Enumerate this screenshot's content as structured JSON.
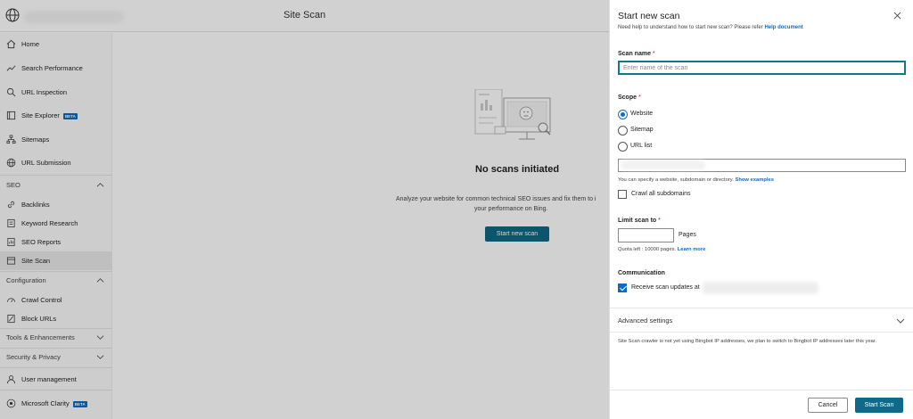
{
  "header": {
    "title": "Site Scan"
  },
  "sidebar": {
    "items": [
      {
        "label": "Home",
        "icon": "home-icon"
      },
      {
        "label": "Search Performance",
        "icon": "trend-icon"
      },
      {
        "label": "URL Inspection",
        "icon": "search-icon"
      },
      {
        "label": "Site Explorer",
        "icon": "folder-icon",
        "badge": "BETA"
      },
      {
        "label": "Sitemaps",
        "icon": "sitemap-icon"
      },
      {
        "label": "URL Submission",
        "icon": "globe-icon"
      }
    ],
    "seo_section": "SEO",
    "seo_items": [
      {
        "label": "Backlinks",
        "icon": "link-icon"
      },
      {
        "label": "Keyword Research",
        "icon": "key-icon"
      },
      {
        "label": "SEO Reports",
        "icon": "report-icon"
      },
      {
        "label": "Site Scan",
        "icon": "scan-icon",
        "active": true
      }
    ],
    "config_section": "Configuration",
    "config_items": [
      {
        "label": "Crawl Control",
        "icon": "gauge-icon"
      },
      {
        "label": "Block URLs",
        "icon": "block-icon"
      }
    ],
    "tools_section": "Tools & Enhancements",
    "security_section": "Security & Privacy",
    "user_mgmt": "User management",
    "clarity": "Microsoft Clarity",
    "clarity_badge": "BETA"
  },
  "main": {
    "empty_title": "No scans initiated",
    "empty_desc_line1": "Analyze your website for common technical SEO issues and fix them to i",
    "empty_desc_line2": "your performance on Bing.",
    "start_button": "Start new scan"
  },
  "panel": {
    "title": "Start new scan",
    "help_text": "Need help to understand how to start new scan? Please refer",
    "help_link": "Help document",
    "scan_name_label": "Scan name",
    "required_mark": "*",
    "scan_name_placeholder": "Enter name of the scan",
    "scope_label": "Scope",
    "scope_options": [
      "Website",
      "Sitemap",
      "URL list"
    ],
    "scope_selected": "Website",
    "scope_hint": "You can specify a website, subdomain or directory.",
    "scope_hint_link": "Show examples",
    "crawl_subdomains": "Crawl all subdomains",
    "limit_label": "Limit scan to",
    "pages_label": "Pages",
    "quota_text": "Quota left : 10000 pages.",
    "quota_link": "Learn more",
    "communication_label": "Communication",
    "receive_updates": "Receive scan updates at",
    "advanced_settings": "Advanced settings",
    "note": "Site Scan crawler is not yet using Bingbot IP addresses, we plan to switch to Bingbot IP addresses later this year.",
    "cancel_button": "Cancel",
    "start_button": "Start Scan"
  },
  "colors": {
    "accent": "#0e6a86",
    "link": "#0f6cbd",
    "focus": "#0e7a87"
  }
}
